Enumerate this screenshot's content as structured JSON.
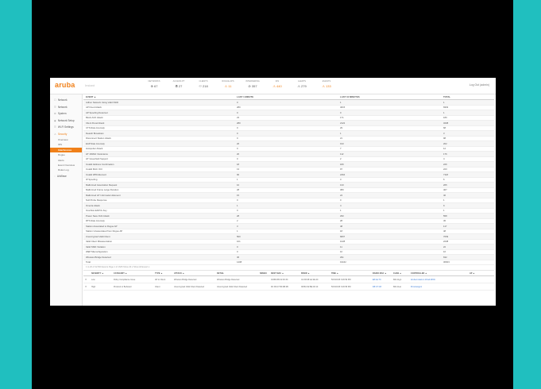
{
  "brand": {
    "logo_text": "aruba",
    "subtitle": "Instant"
  },
  "header": {
    "stats": [
      {
        "label": "NETWORKS",
        "value": "⊕ 67"
      },
      {
        "label": "ACCESS PT",
        "value": "⦾ 27"
      },
      {
        "label": "CLIENTS",
        "value": "⚇ 218"
      },
      {
        "label": "ROGUE APS",
        "value": "⚠ 11"
      },
      {
        "label": "INTERFERING",
        "value": "⊘ 357"
      },
      {
        "label": "IDS",
        "value": "⚠ 440"
      },
      {
        "label": "ALERTS",
        "value": "⚠ 279"
      },
      {
        "label": "EVENTS",
        "value": "⚠ 133"
      }
    ],
    "logout": "Log Out (admin)"
  },
  "sidebar": {
    "items": [
      {
        "icon": "☐",
        "label": "Network"
      },
      {
        "icon": "☰",
        "label": "Network"
      },
      {
        "icon": "⚙",
        "label": "System"
      },
      {
        "icon": "◉",
        "label": "Network Setup"
      },
      {
        "icon": "☰",
        "label": "Wi-Fi Settings"
      },
      {
        "icon": "⚠",
        "label": "Security"
      }
    ],
    "security_sub": [
      "Overview",
      "IDS",
      "Interference",
      "Rogue",
      "Alerts",
      "Event Overview",
      "Rules Log"
    ],
    "last": {
      "icon": "◌",
      "label": "AirWave"
    }
  },
  "ids_table": {
    "headers": [
      "EVENT ▲",
      "LAST 1 MINUTE",
      "LAST 10 MINUTES",
      "TOTAL"
    ],
    "rows": [
      [
        "Adhoc Network Using Valid SSID",
        "0",
        "1",
        "1"
      ],
      [
        "AP Flood Attack",
        "280",
        "4615",
        "6963"
      ],
      [
        "AP Spoofing Detected",
        "0",
        "0",
        "1"
      ],
      [
        "Block ACK Attack",
        "23",
        "171",
        "180"
      ],
      [
        "Client Flood Attack",
        "280",
        "2122",
        "3208"
      ],
      [
        "CTS Rate Anomaly",
        "0",
        "29",
        "68"
      ],
      [
        "Deauth Broadcast",
        "0",
        "1",
        "3"
      ],
      [
        "Disconnect Station Attack",
        "0",
        "21",
        "98"
      ],
      [
        "EAP Rate Anomaly",
        "26",
        "193",
        "202"
      ],
      [
        "Hotspotter Attack",
        "0",
        "7",
        "12"
      ],
      [
        "HT 40MHz Intolerance",
        "20",
        "112",
        "176"
      ],
      [
        "HT Greenfield Support",
        "0",
        "2",
        "4"
      ],
      [
        "Invalid Address Combination",
        "18",
        "180",
        "226"
      ],
      [
        "Invalid MAC OUI",
        "13",
        "97",
        "223"
      ],
      [
        "Invalid WPA Element",
        "90",
        "2464",
        "7118"
      ],
      [
        "IP Spoofing",
        "1",
        "3",
        "6"
      ],
      [
        "Malformed Association Request",
        "10",
        "133",
        "265"
      ],
      [
        "Malformed Frame Large Duration",
        "28",
        "380",
        "467"
      ],
      [
        "Malformed HT Information Element",
        "15",
        "24",
        "46"
      ],
      [
        "Null Probe Response",
        "0",
        "0",
        "1"
      ],
      [
        "Omerta Attack",
        "1",
        "4",
        "9"
      ],
      [
        "Overflow EAPOL Key",
        "0",
        "1",
        "1"
      ],
      [
        "Power Save DoS Attack",
        "28",
        "290",
        "558"
      ],
      [
        "RTS Rate Anomaly",
        "2",
        "28",
        "45"
      ],
      [
        "Station Associated to Rogue AP",
        "3",
        "48",
        "117"
      ],
      [
        "Station Unassociated from Rogue AP",
        "1",
        "18",
        "48"
      ],
      [
        "Unencrypted Valid Client",
        "500",
        "6807",
        "7069"
      ],
      [
        "Valid Client Misassociation",
        "101",
        "1028",
        "2238"
      ],
      [
        "Valid SSID Violation",
        "0",
        "11",
        "22"
      ],
      [
        "WEP Misconfiguration",
        "0",
        "10",
        "16"
      ],
      [
        "Wireless Bridge Detected",
        "36",
        "291",
        "632"
      ],
      [
        "Total",
        "1408",
        "19162",
        "30603"
      ]
    ]
  },
  "pager": {
    "text": "1 to 20 of 32,500 Events   Page  1  of 1625     Show 20 ▾   Show All   Export ▾"
  },
  "events_table": {
    "headers": [
      "",
      "SEVERITY ▲",
      "CATEGORY ▲",
      "TYPE ▲",
      "ATTACK ▲",
      "DETAIL",
      "SRMAC",
      "DEST MAC ▲",
      "BSSID ▲",
      "TIME ▲",
      "RADIO MAC ▲",
      "CHAN ▲",
      "CONTROLLER ▲",
      "AP ▲"
    ],
    "rows": [
      [
        "☐",
        "Low",
        "Policy Compliance Issue",
        "AP to Client",
        "Wireless Bridge Detected",
        "Wireless Bridge Detected",
        "",
        "04:BD:88:C2:F0:30",
        "C2:38:08:AA:2E:40",
        "5/15/2015 3:26:59 PM",
        "E8:AA:7C",
        "802.11gn",
        "Aruba-Instant-1.18:a2:d8:8c",
        ""
      ],
      [
        "☐",
        "High",
        "Protocol or Behavior",
        "Client",
        "Unencrypted Valid Client Detected",
        "Unencrypted Valid Client Detected",
        "",
        "9C:D9:17:B0:9B:2B",
        "38:BA:92:BE:00:10",
        "5/15/2015 3:26:58 PM",
        "D8:C7:C8",
        "802.11ac",
        "ProvAssign1",
        ""
      ]
    ]
  }
}
